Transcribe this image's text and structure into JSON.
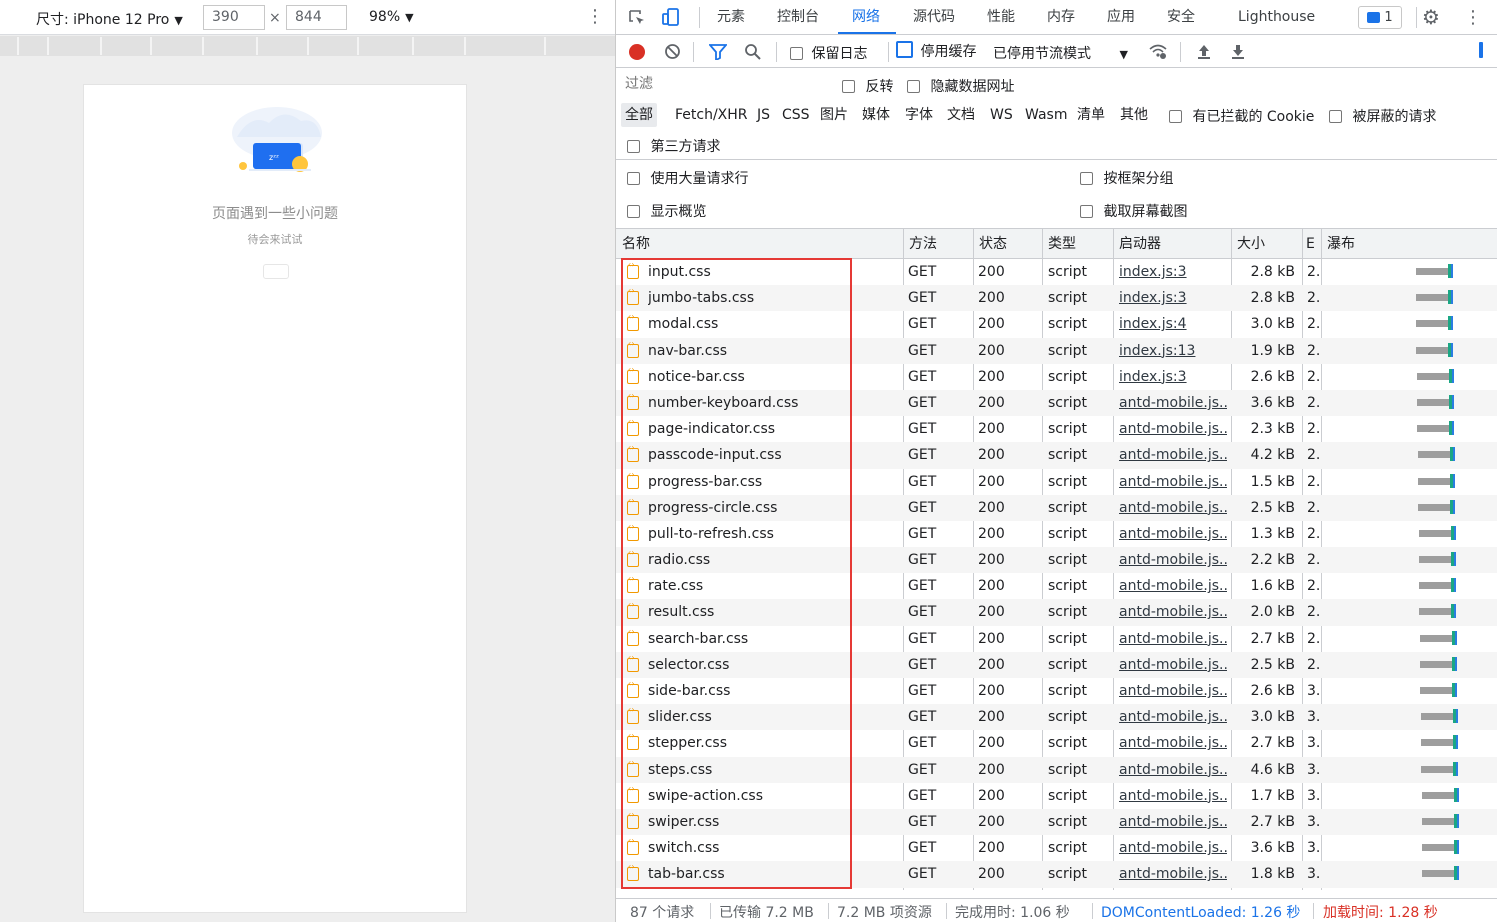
{
  "device_toolbar": {
    "device_label": "尺寸: iPhone 12 Pro",
    "width": "390",
    "height": "844",
    "times": "×",
    "zoom": "98%"
  },
  "device_page": {
    "error_title": "页面遇到一些小问题",
    "error_subtitle": "待会来试试"
  },
  "devtools_tabs": [
    "元素",
    "控制台",
    "网络",
    "源代码",
    "性能",
    "内存",
    "应用",
    "安全",
    "Lighthouse"
  ],
  "active_tab": "网络",
  "issues_count": "1",
  "network_toolbar": {
    "preserve_log": "保留日志",
    "disable_cache": "停用缓存",
    "throttling": "已停用节流模式"
  },
  "filter": {
    "placeholder": "过滤",
    "invert": "反转",
    "hide_data_urls": "隐藏数据网址",
    "types": [
      "全部",
      "Fetch/XHR",
      "JS",
      "CSS",
      "图片",
      "媒体",
      "字体",
      "文档",
      "WS",
      "Wasm",
      "清单",
      "其他"
    ],
    "blocked_cookies": "有已拦截的 Cookie",
    "blocked_requests": "被屏蔽的请求",
    "third_party": "第三方请求",
    "large_rows": "使用大量请求行",
    "group_by_frame": "按框架分组",
    "show_overview": "显示概览",
    "capture_screenshots": "截取屏幕截图"
  },
  "columns": {
    "name": "名称",
    "method": "方法",
    "status": "状态",
    "type": "类型",
    "initiator": "启动器",
    "size": "大小",
    "time": "E",
    "waterfall": "瀑布"
  },
  "requests": [
    {
      "name": "input.css",
      "method": "GET",
      "status": "200",
      "type": "script",
      "initiator": "index.js:3",
      "size": "2.8 kB",
      "time": "2..."
    },
    {
      "name": "jumbo-tabs.css",
      "method": "GET",
      "status": "200",
      "type": "script",
      "initiator": "index.js:3",
      "size": "2.8 kB",
      "time": "2..."
    },
    {
      "name": "modal.css",
      "method": "GET",
      "status": "200",
      "type": "script",
      "initiator": "index.js:4",
      "size": "3.0 kB",
      "time": "2..."
    },
    {
      "name": "nav-bar.css",
      "method": "GET",
      "status": "200",
      "type": "script",
      "initiator": "index.js:13",
      "size": "1.9 kB",
      "time": "2..."
    },
    {
      "name": "notice-bar.css",
      "method": "GET",
      "status": "200",
      "type": "script",
      "initiator": "index.js:3",
      "size": "2.6 kB",
      "time": "2..."
    },
    {
      "name": "number-keyboard.css",
      "method": "GET",
      "status": "200",
      "type": "script",
      "initiator": "antd-mobile.js...",
      "size": "3.6 kB",
      "time": "2..."
    },
    {
      "name": "page-indicator.css",
      "method": "GET",
      "status": "200",
      "type": "script",
      "initiator": "antd-mobile.js...",
      "size": "2.3 kB",
      "time": "2..."
    },
    {
      "name": "passcode-input.css",
      "method": "GET",
      "status": "200",
      "type": "script",
      "initiator": "antd-mobile.js...",
      "size": "4.2 kB",
      "time": "2..."
    },
    {
      "name": "progress-bar.css",
      "method": "GET",
      "status": "200",
      "type": "script",
      "initiator": "antd-mobile.js...",
      "size": "1.5 kB",
      "time": "2..."
    },
    {
      "name": "progress-circle.css",
      "method": "GET",
      "status": "200",
      "type": "script",
      "initiator": "antd-mobile.js...",
      "size": "2.5 kB",
      "time": "2..."
    },
    {
      "name": "pull-to-refresh.css",
      "method": "GET",
      "status": "200",
      "type": "script",
      "initiator": "antd-mobile.js...",
      "size": "1.3 kB",
      "time": "2..."
    },
    {
      "name": "radio.css",
      "method": "GET",
      "status": "200",
      "type": "script",
      "initiator": "antd-mobile.js...",
      "size": "2.2 kB",
      "time": "2..."
    },
    {
      "name": "rate.css",
      "method": "GET",
      "status": "200",
      "type": "script",
      "initiator": "antd-mobile.js...",
      "size": "1.6 kB",
      "time": "2..."
    },
    {
      "name": "result.css",
      "method": "GET",
      "status": "200",
      "type": "script",
      "initiator": "antd-mobile.js...",
      "size": "2.0 kB",
      "time": "2..."
    },
    {
      "name": "search-bar.css",
      "method": "GET",
      "status": "200",
      "type": "script",
      "initiator": "antd-mobile.js...",
      "size": "2.7 kB",
      "time": "2..."
    },
    {
      "name": "selector.css",
      "method": "GET",
      "status": "200",
      "type": "script",
      "initiator": "antd-mobile.js...",
      "size": "2.5 kB",
      "time": "2..."
    },
    {
      "name": "side-bar.css",
      "method": "GET",
      "status": "200",
      "type": "script",
      "initiator": "antd-mobile.js...",
      "size": "2.6 kB",
      "time": "3..."
    },
    {
      "name": "slider.css",
      "method": "GET",
      "status": "200",
      "type": "script",
      "initiator": "antd-mobile.js...",
      "size": "3.0 kB",
      "time": "3..."
    },
    {
      "name": "stepper.css",
      "method": "GET",
      "status": "200",
      "type": "script",
      "initiator": "antd-mobile.js...",
      "size": "2.7 kB",
      "time": "3..."
    },
    {
      "name": "steps.css",
      "method": "GET",
      "status": "200",
      "type": "script",
      "initiator": "antd-mobile.js...",
      "size": "4.6 kB",
      "time": "3..."
    },
    {
      "name": "swipe-action.css",
      "method": "GET",
      "status": "200",
      "type": "script",
      "initiator": "antd-mobile.js...",
      "size": "1.7 kB",
      "time": "3..."
    },
    {
      "name": "swiper.css",
      "method": "GET",
      "status": "200",
      "type": "script",
      "initiator": "antd-mobile.js...",
      "size": "2.7 kB",
      "time": "3..."
    },
    {
      "name": "switch.css",
      "method": "GET",
      "status": "200",
      "type": "script",
      "initiator": "antd-mobile.js...",
      "size": "3.6 kB",
      "time": "3..."
    },
    {
      "name": "tab-bar.css",
      "method": "GET",
      "status": "200",
      "type": "script",
      "initiator": "antd-mobile.js...",
      "size": "1.8 kB",
      "time": "3..."
    }
  ],
  "status_bar": {
    "requests": "87 个请求",
    "transferred": "已传输 7.2 MB",
    "resources": "7.2 MB 项资源",
    "finish": "完成用时: 1.06 秒",
    "dom_content_loaded": "DOMContentLoaded: 1.26 秒",
    "load": "加载时间: 1.28 秒"
  },
  "colors": {
    "accent": "#1a73e8",
    "highlight_box": "#e53935",
    "load_time": "#d93025",
    "file_icon": "#f29900",
    "record": "#d93025"
  }
}
